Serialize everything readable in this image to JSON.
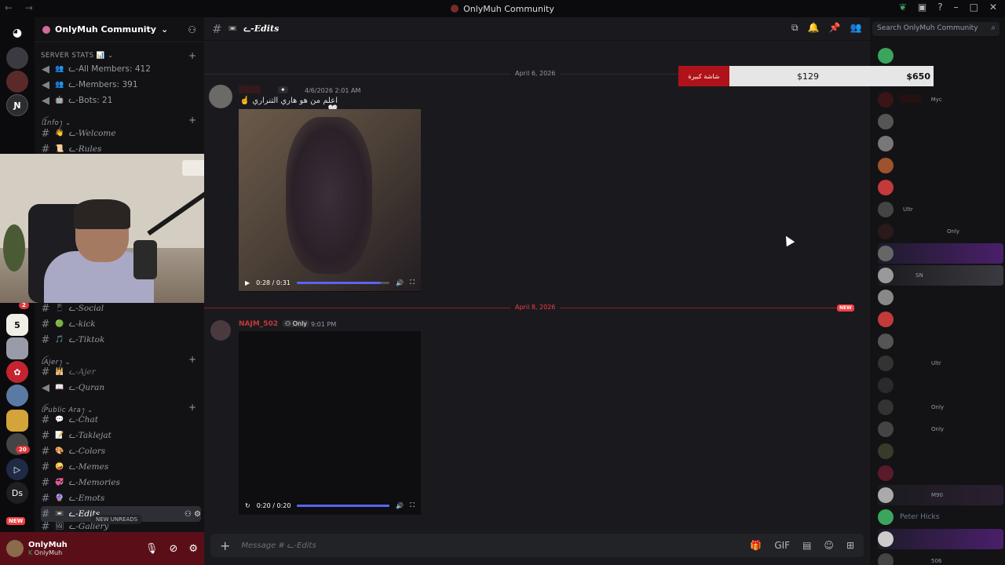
{
  "window": {
    "title": "OnlyMuh Community"
  },
  "server": {
    "name": "OnlyMuh Community"
  },
  "guilds": {
    "badge_top": "2",
    "badge_20": "20",
    "new_label": "NEW",
    "ds_label": "Ds"
  },
  "categories": {
    "server_stats": "SERVER STATS 📊",
    "info": "ꪶ𝘐𝘯𝘧𝘰ꫂ",
    "ajer": "ꪶ𝘈𝘫𝘦𝘳ꫂ",
    "public": "ꪶ𝘗𝘶𝘣𝘭𝘪𝘤 𝘈𝘳𝘢ꫂ"
  },
  "channels": {
    "all_members": "ᓚ-All Members: 412",
    "members": "ᓚ-Members: 391",
    "bots": "ᓚ-Bots: 21",
    "welcome": "ᓚ-Welcome",
    "rules": "ᓚ-Rules",
    "social": "ᓚ-Social",
    "kick": "ᓚ-kick",
    "tiktok": "ᓚ-Tiktok",
    "ajer": "ᓚ-Ajer",
    "quran": "ᓚ-Quran",
    "chat": "ᓚ-Chat",
    "taklejat": "ᓚ-Taklejat",
    "colors": "ᓚ-Colors",
    "memes": "ᓚ-Memes",
    "memories": "ᓚ-Memories",
    "emots": "ᓚ-Emots",
    "edits": "ᓚ-Edits",
    "gallery": "ᓚ-Gallery"
  },
  "unreads": {
    "label": "NEW UNREADS"
  },
  "user": {
    "name": "OnlyMuh",
    "status": "OnlyMuh"
  },
  "channel_header": {
    "name": "ᓚ-Edits"
  },
  "search": {
    "placeholder": "Search OnlyMuh Community"
  },
  "messages": {
    "date1": "April 6, 2026",
    "msg1_time": "4/6/2026 2:01 AM",
    "msg1_text": "اعلم من هو هاري التنراري ☝️🤍",
    "video1_time": "0:28 / 0:31",
    "video1_progress": 0.9,
    "date2": "April 8, 2026",
    "new_label": "NEW",
    "msg2_name": "NAJM_502",
    "msg2_role": "Only",
    "msg2_time": "9:01 PM",
    "video2_time": "0:20 / 0:20",
    "video2_progress": 1.0
  },
  "composer": {
    "placeholder": "Message # ᓚ-Edits"
  },
  "overlay": {
    "label": "شاشة كبيرة",
    "left_value": "$129",
    "right_value": "$650"
  },
  "member_list": {
    "tag_myc": "Myc",
    "tag_ultr": "Ultr",
    "tag_only": "Only",
    "tag_sn": "SN",
    "tag_m90": "M90",
    "tag_506": "506",
    "peter": "Peter Hicks"
  }
}
